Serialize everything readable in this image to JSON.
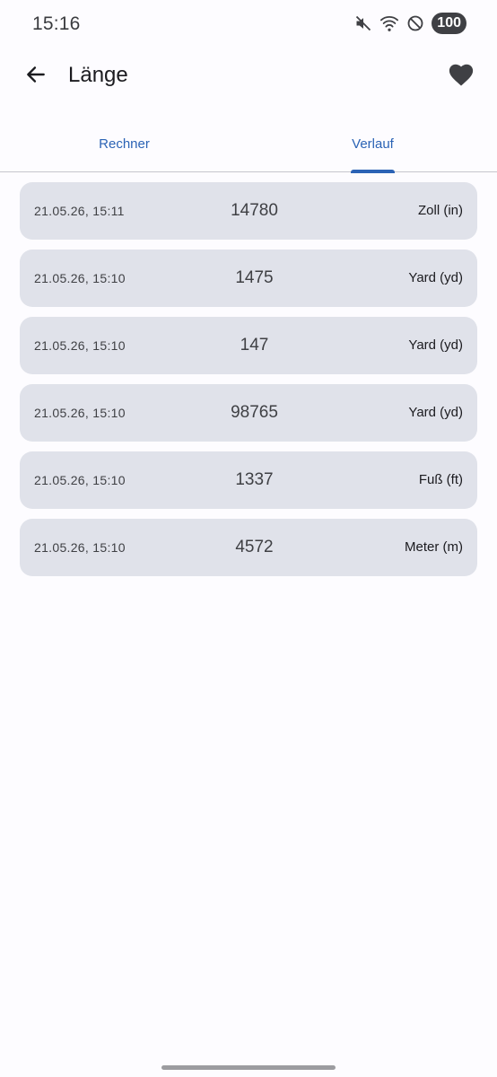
{
  "status_bar": {
    "time": "15:16",
    "icons": [
      "mute-icon",
      "wifi-icon",
      "do-not-disturb-icon"
    ],
    "battery": "100"
  },
  "top_bar": {
    "back_icon": "arrow-back-icon",
    "title": "Länge",
    "favorite_icon": "heart-icon"
  },
  "tabs": [
    {
      "label": "Rechner",
      "selected": false
    },
    {
      "label": "Verlauf",
      "selected": true
    }
  ],
  "history": [
    {
      "time": "21.05.26, 15:11",
      "value": "14780",
      "unit": "Zoll (in)"
    },
    {
      "time": "21.05.26, 15:10",
      "value": "1475",
      "unit": "Yard (yd)"
    },
    {
      "time": "21.05.26, 15:10",
      "value": "147",
      "unit": "Yard (yd)"
    },
    {
      "time": "21.05.26, 15:10",
      "value": "98765",
      "unit": "Yard (yd)"
    },
    {
      "time": "21.05.26, 15:10",
      "value": "1337",
      "unit": "Fuß (ft)"
    },
    {
      "time": "21.05.26, 15:10",
      "value": "4572",
      "unit": "Meter (m)"
    }
  ],
  "colors": {
    "accent": "#2b63b5",
    "card_background": "#e0e2ea",
    "page_background": "#fdfcff"
  }
}
